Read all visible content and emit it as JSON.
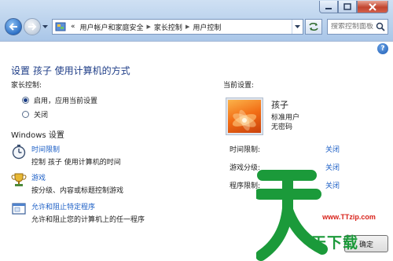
{
  "window": {
    "minimize_icon": "minimize-icon",
    "maximize_icon": "maximize-icon",
    "close_icon": "close-icon"
  },
  "nav": {
    "back_icon": "back-arrow-icon",
    "forward_icon": "forward-arrow-icon",
    "address": {
      "overflow": "«",
      "crumbs": [
        "用户帐户和家庭安全",
        "家长控制",
        "用户控制"
      ]
    },
    "search_placeholder": "搜索控制面板"
  },
  "main": {
    "help": "?",
    "title": "设置 孩子 使用计算机的方式",
    "parental_control_label": "家长控制:",
    "options": [
      {
        "label": "启用，应用当前设置",
        "selected": true
      },
      {
        "label": "关闭",
        "selected": false
      }
    ],
    "windows_settings_label": "Windows 设置",
    "settings": [
      {
        "icon": "stopwatch-icon",
        "link": "时间限制",
        "desc": "控制 孩子 使用计算机的时间"
      },
      {
        "icon": "trophy-icon",
        "link": "游戏",
        "desc": "按分级、内容或标题控制游戏"
      },
      {
        "icon": "program-window-icon",
        "link": "允许和阻止特定程序",
        "desc": "允许和阻止您的计算机上的任一程序"
      }
    ]
  },
  "current": {
    "label": "当前设置:",
    "user_name": "孩子",
    "user_type": "标准用户",
    "password": "无密码",
    "rows": [
      {
        "key": "时间限制:",
        "value": "关闭"
      },
      {
        "key": "游戏分级:",
        "value": "关闭"
      },
      {
        "key": "程序限制:",
        "value": "关闭"
      }
    ]
  },
  "footer": {
    "ok_label": "确定"
  },
  "watermark": {
    "url": "www.TTzip.com",
    "text": "天下载"
  },
  "colors": {
    "link": "#1c5fc6",
    "title": "#1e3d87",
    "watermark_red": "#d8231b",
    "watermark_green": "#1b9a3a"
  }
}
